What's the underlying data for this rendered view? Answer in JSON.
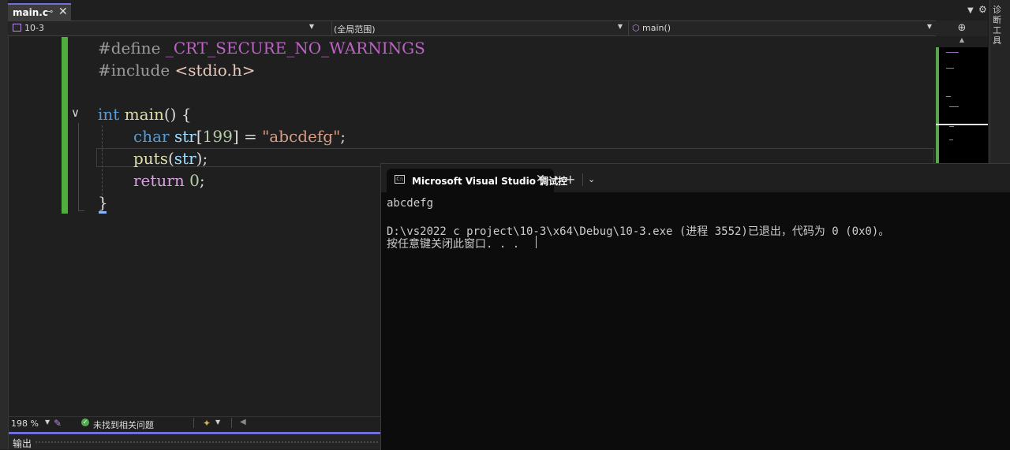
{
  "tab": {
    "filename": "main.c",
    "pin_glyph": "⊸",
    "close_glyph": "✕"
  },
  "nav": {
    "project": "10-3",
    "scope": "(全局范围)",
    "member": "main()"
  },
  "right_tools": {
    "label": "诊断工具",
    "split_glyph": "⊕"
  },
  "code": {
    "line1": {
      "directive": "#define",
      "macro": "_CRT_SECURE_NO_WARNINGS"
    },
    "line2": {
      "directive": "#include",
      "header": "<stdio.h>"
    },
    "line4": {
      "type": "int",
      "func": "main",
      "rest": "() {"
    },
    "line5": {
      "type": "char",
      "name": "str",
      "open": "[",
      "size": "199",
      "close": "] = ",
      "string": "\"abcdefg\"",
      "end": ";"
    },
    "line6": {
      "func": "puts",
      "open": "(",
      "arg": "str",
      "end": ");"
    },
    "line7": {
      "kw": "return",
      "num": "0",
      "end": ";"
    },
    "line8": {
      "brace": "}"
    }
  },
  "status": {
    "zoom": "198 %",
    "issues": "未找到相关问题"
  },
  "output": {
    "title": "输出"
  },
  "console": {
    "tab_label": "Microsoft Visual Studio 调试控",
    "icon_text": "C:\\",
    "lines": [
      "abcdefg",
      "",
      "D:\\vs2022 c project\\10-3\\x64\\Debug\\10-3.exe (进程 3552)已退出，代码为 0 (0x0)。",
      "按任意键关闭此窗口. . ."
    ]
  },
  "colors": {
    "change_bar": "#4fae3e",
    "accent": "#6f6fd8",
    "keyword": "#569cd6",
    "control_keyword": "#d8a0df",
    "string": "#d69d85",
    "function": "#dcdcaa",
    "console_bg": "#0c0c0c"
  }
}
